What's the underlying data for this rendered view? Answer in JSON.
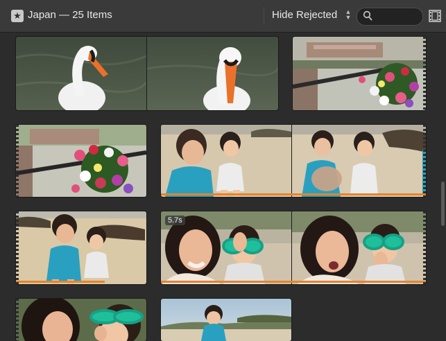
{
  "toolbar": {
    "star_glyph": "★",
    "title": "Japan — 25 Items",
    "filter_label": "Hide Rejected",
    "search_placeholder": "",
    "icons": [
      "star-icon",
      "search-icon",
      "filmstrip-icon"
    ]
  },
  "clips": [
    {
      "name": "clip-swan",
      "duration_label": null,
      "selected": false,
      "frames": [
        "swan",
        "swan-closeup"
      ]
    },
    {
      "name": "clip-flowers-bridge-1",
      "duration_label": null,
      "selected": false,
      "frames": [
        "flowers-bridge"
      ]
    },
    {
      "name": "clip-flowers-bridge-2",
      "duration_label": null,
      "selected": false,
      "frames": [
        "flowers-bridge"
      ]
    },
    {
      "name": "clip-kids-beach-1",
      "duration_label": null,
      "selected": true,
      "frames": [
        "kids-beach",
        "kids-beach-hand"
      ]
    },
    {
      "name": "clip-kids-beach-2",
      "duration_label": null,
      "selected": true,
      "frames": [
        "kids-beach"
      ]
    },
    {
      "name": "clip-mother-goggles",
      "duration_label": "5.7s",
      "selected": true,
      "frames": [
        "mother-goggles",
        "mother-goggles"
      ]
    },
    {
      "name": "clip-goggles-closeup",
      "duration_label": null,
      "selected": false,
      "frames": [
        "goggles-closeup"
      ]
    },
    {
      "name": "clip-child-shore",
      "duration_label": null,
      "selected": false,
      "frames": [
        "child-shore"
      ]
    }
  ],
  "colors": {
    "selection": "#e8832a",
    "toolbar_bg": "#3a3a3a",
    "browser_bg": "#2c2c2c"
  }
}
